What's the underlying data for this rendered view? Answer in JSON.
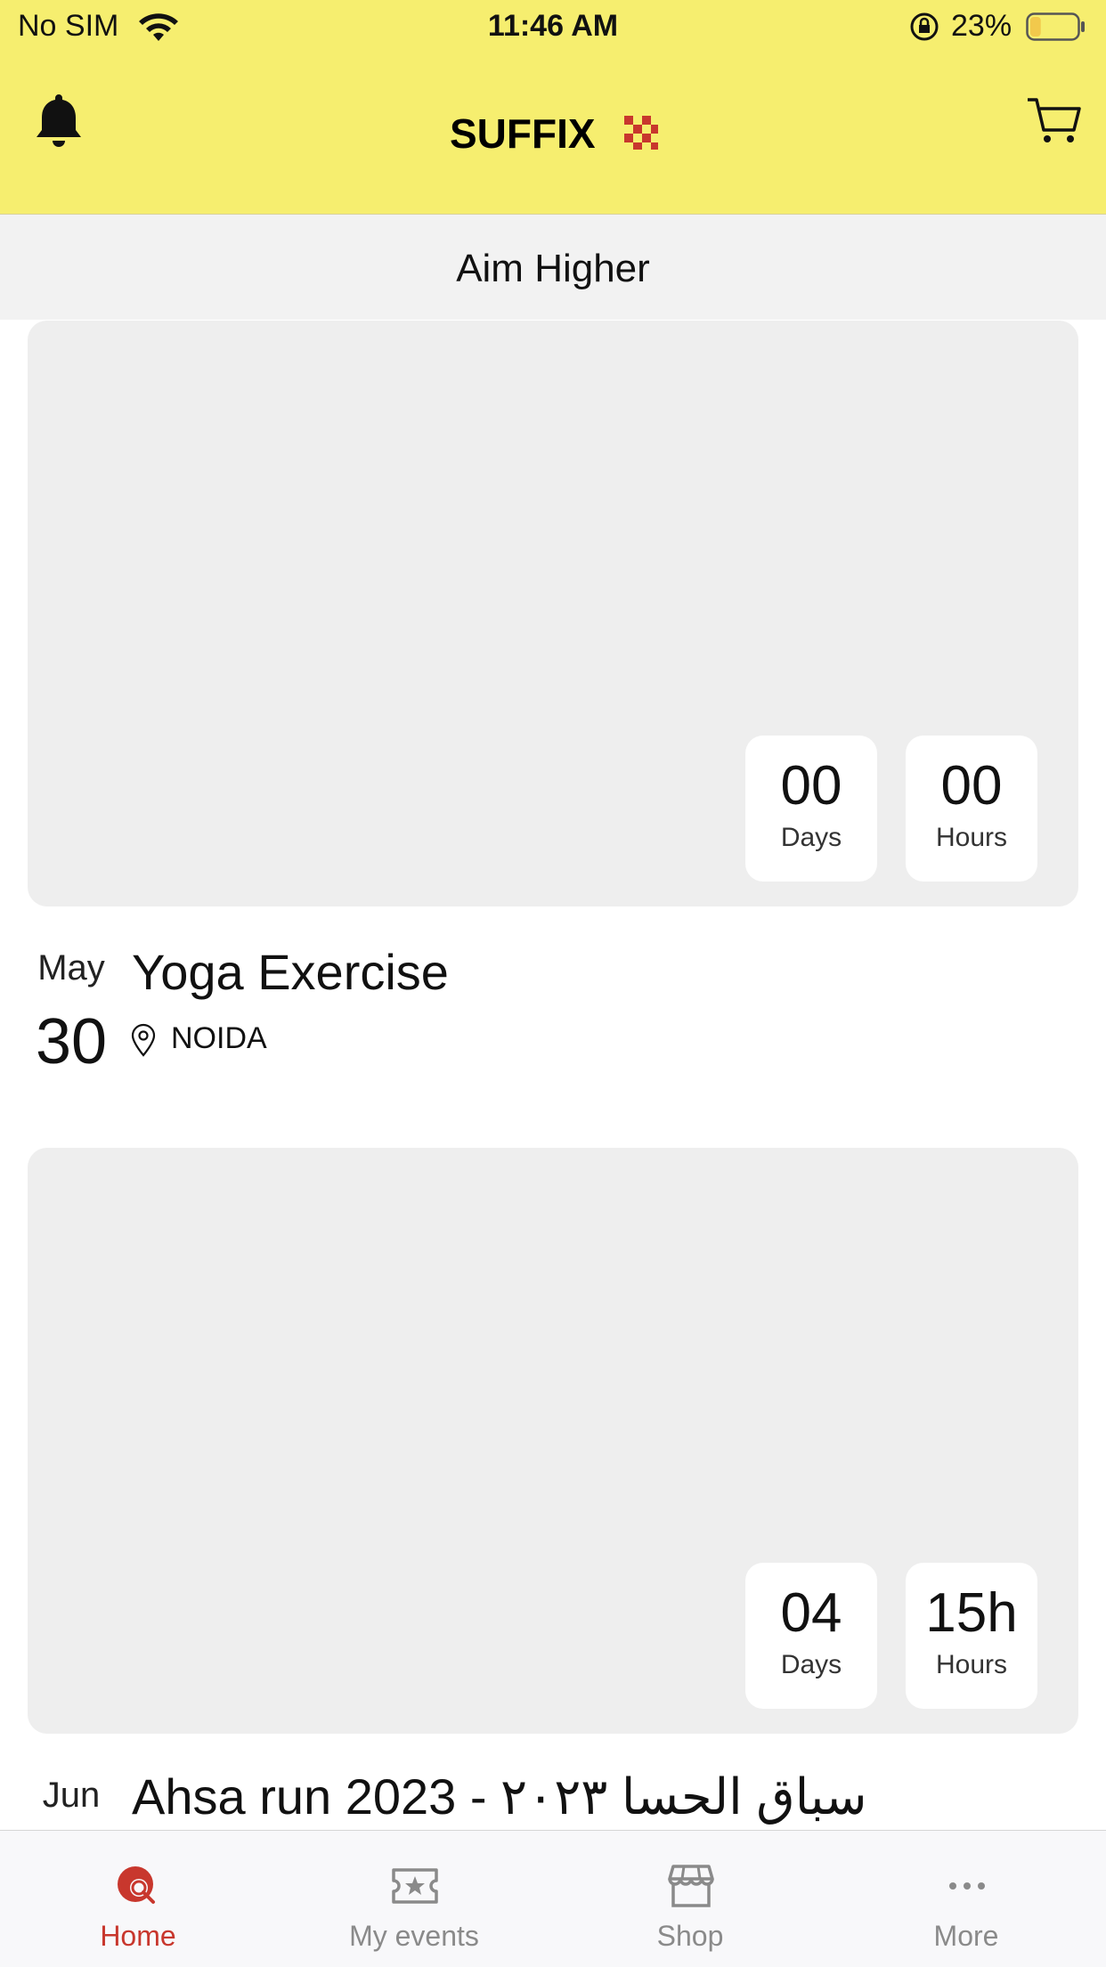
{
  "status_bar": {
    "carrier": "No SIM",
    "time": "11:46 AM",
    "battery_percent": "23%",
    "battery_level": 0.23
  },
  "header": {
    "logo_text": "SUFFIX",
    "brand_colors": {
      "yellow": "#f6ee6f",
      "red": "#c8372d"
    },
    "icons": [
      "bell-icon",
      "cart-icon"
    ]
  },
  "subheader": {
    "title": "Aim Higher"
  },
  "events": [
    {
      "month": "May",
      "day": "30",
      "title": "Yoga Exercise",
      "location": "NOIDA",
      "countdown": [
        {
          "value": "00",
          "label": "Days"
        },
        {
          "value": "00",
          "label": "Hours"
        }
      ]
    },
    {
      "month": "Jun",
      "day": "",
      "title": "Ahsa run 2023 - سباق الحسا ٢٠٢٣",
      "location": "",
      "countdown": [
        {
          "value": "04",
          "label": "Days"
        },
        {
          "value": "15h",
          "label": "Hours"
        }
      ]
    }
  ],
  "tabbar": {
    "tabs": [
      {
        "label": "Home",
        "icon": "home-search-icon",
        "active": true
      },
      {
        "label": "My events",
        "icon": "ticket-star-icon",
        "active": false
      },
      {
        "label": "Shop",
        "icon": "store-icon",
        "active": false
      },
      {
        "label": "More",
        "icon": "more-dots-icon",
        "active": false
      }
    ]
  }
}
